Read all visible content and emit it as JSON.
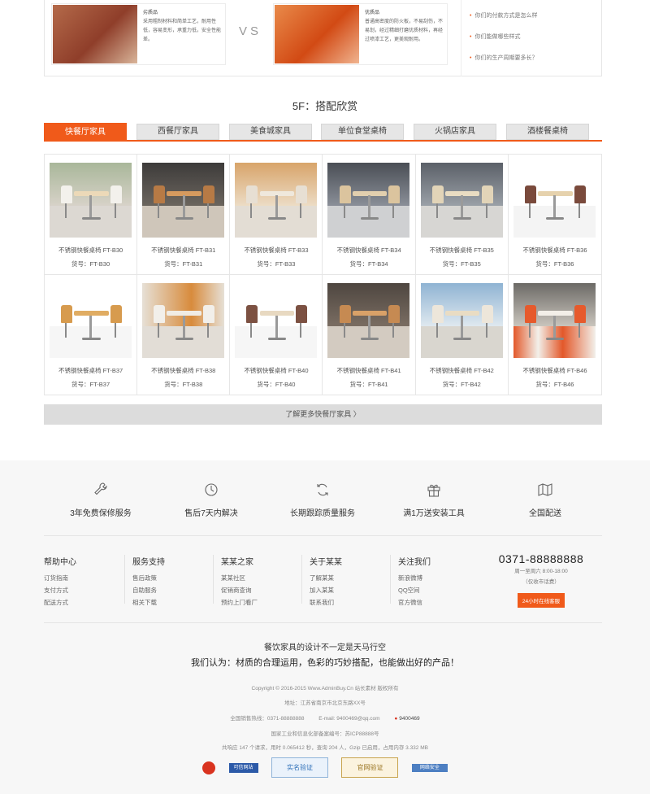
{
  "compare": {
    "left": {
      "title": "劣质品",
      "text": "采用粗制材料和简单工艺，耐用性低，容易变形，承重力低，安全性能差。"
    },
    "vs": "VS",
    "right": {
      "title": "优质品",
      "text": "普通高密度的防火板，不易刮伤，不易划，经过精细打磨优质材料，再经过喷漆工艺，更美观耐用。"
    },
    "faq": [
      "你们的付款方式是怎么样",
      "你们能做哪些样式",
      "你们的生产周期要多长？"
    ]
  },
  "section": {
    "title": "5F：搭配欣赏"
  },
  "tabs": [
    "快餐厅家具",
    "西餐厅家具",
    "美食城家具",
    "单位食堂桌椅",
    "火锅店家具",
    "酒楼餐桌椅"
  ],
  "products": [
    {
      "name": "不锈钢快餐桌椅 FT-B30",
      "code": "货号：FT-B30"
    },
    {
      "name": "不锈钢快餐桌椅 FT-B31",
      "code": "货号：FT-B31"
    },
    {
      "name": "不锈钢快餐桌椅 FT-B33",
      "code": "货号：FT-B33"
    },
    {
      "name": "不锈钢快餐桌椅 FT-B34",
      "code": "货号：FT-B34"
    },
    {
      "name": "不锈钢快餐桌椅 FT-B35",
      "code": "货号：FT-B35"
    },
    {
      "name": "不锈钢快餐桌椅 FT-B36",
      "code": "货号：FT-B36"
    },
    {
      "name": "不锈钢快餐桌椅 FT-B37",
      "code": "货号：FT-B37"
    },
    {
      "name": "不锈钢快餐桌椅 FT-B38",
      "code": "货号：FT-B38"
    },
    {
      "name": "不锈钢快餐桌椅 FT-B40",
      "code": "货号：FT-B40"
    },
    {
      "name": "不锈钢快餐桌椅 FT-B41",
      "code": "货号：FT-B41"
    },
    {
      "name": "不锈钢快餐桌椅 FT-B42",
      "code": "货号：FT-B42"
    },
    {
      "name": "不锈钢快餐桌椅 FT-B46",
      "code": "货号：FT-B46"
    }
  ],
  "more_link": "了解更多快餐厅家具 〉",
  "services": [
    {
      "icon": "wrench-icon",
      "label": "3年免费保修服务"
    },
    {
      "icon": "clock-icon",
      "label": "售后7天内解决"
    },
    {
      "icon": "refresh-icon",
      "label": "长期跟踪质量服务"
    },
    {
      "icon": "gift-icon",
      "label": "满1万送安装工具"
    },
    {
      "icon": "map-icon",
      "label": "全国配送"
    }
  ],
  "footer_cols": [
    {
      "title": "帮助中心",
      "links": [
        "订货指南",
        "支付方式",
        "配送方式"
      ]
    },
    {
      "title": "服务支持",
      "links": [
        "售后政策",
        "自助服务",
        "相关下载"
      ]
    },
    {
      "title": "某某之家",
      "links": [
        "某某社区",
        "促销商查询",
        "预约上门看厂"
      ]
    },
    {
      "title": "关于某某",
      "links": [
        "了解某某",
        "加入某某",
        "联系我们"
      ]
    },
    {
      "title": "关注我们",
      "links": [
        "新浪微博",
        "QQ空间",
        "官方微信"
      ]
    }
  ],
  "contact": {
    "phone": "0371-88888888",
    "hours": "周一至周六 8:00-18:00",
    "hours_note": "（仅收市话费）",
    "button": "24小时在线客服"
  },
  "slogan": {
    "line1": "餐饮家具的设计不一定是天马行空",
    "line2": "我们认为：材质的合理运用，色彩的巧妙搭配，也能做出好的产品！"
  },
  "footer_info": {
    "copyright": "Copyright © 2016-2015 Www.AdminBuy.Cn 站长素材 版权所有",
    "address": "地址：江苏省南京市北京东路XX号",
    "hotline": "全国销售热线：0371-88888888",
    "email": "E-mail: 9400469@qq.com",
    "qq": "9400469",
    "icp": "国家工业和信息化部备案编号：苏ICP88888号",
    "stats": "共响应 147 个请求，用时 0.065412 秒，查询 204 人，Gzip 已启用，占用内存 3.332 MB"
  },
  "badges": [
    "网警备案",
    "可信网站",
    "实名验证",
    "官网验证",
    "网络安全"
  ]
}
